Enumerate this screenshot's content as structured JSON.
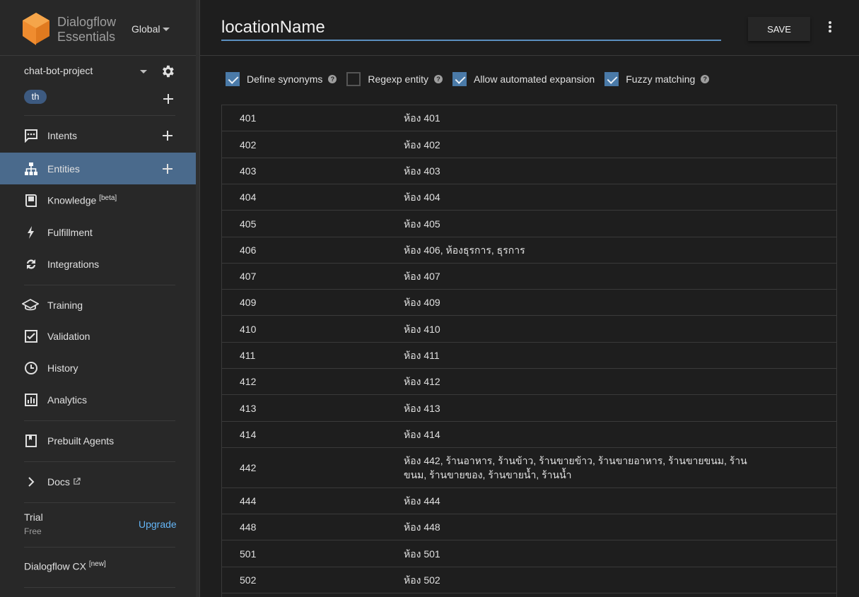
{
  "brand": {
    "line1": "Dialogflow",
    "line2": "Essentials",
    "region": "Global"
  },
  "project": {
    "name": "chat-bot-project",
    "language": "th"
  },
  "nav": {
    "intents": "Intents",
    "entities": "Entities",
    "knowledge": "Knowledge",
    "knowledge_badge": "[beta]",
    "fulfillment": "Fulfillment",
    "integrations": "Integrations",
    "training": "Training",
    "validation": "Validation",
    "history": "History",
    "analytics": "Analytics",
    "prebuilt": "Prebuilt Agents",
    "docs": "Docs"
  },
  "plan": {
    "title": "Trial",
    "sub": "Free",
    "upgrade": "Upgrade"
  },
  "cx": {
    "label": "Dialogflow CX",
    "badge": "[new]"
  },
  "header": {
    "entity_name": "locationName",
    "save": "SAVE"
  },
  "options": {
    "define_synonyms": "Define synonyms",
    "regexp": "Regexp entity",
    "expansion": "Allow automated expansion",
    "fuzzy": "Fuzzy matching"
  },
  "rows": [
    {
      "ref": "401",
      "syn": "ห้อง 401"
    },
    {
      "ref": "402",
      "syn": "ห้อง 402"
    },
    {
      "ref": "403",
      "syn": "ห้อง 403"
    },
    {
      "ref": "404",
      "syn": "ห้อง 404"
    },
    {
      "ref": "405",
      "syn": "ห้อง 405"
    },
    {
      "ref": "406",
      "syn": "ห้อง 406, ห้องธุรการ, ธุรการ"
    },
    {
      "ref": "407",
      "syn": "ห้อง 407"
    },
    {
      "ref": "409",
      "syn": "ห้อง 409"
    },
    {
      "ref": "410",
      "syn": "ห้อง 410"
    },
    {
      "ref": "411",
      "syn": "ห้อง 411"
    },
    {
      "ref": "412",
      "syn": "ห้อง 412"
    },
    {
      "ref": "413",
      "syn": "ห้อง 413"
    },
    {
      "ref": "414",
      "syn": "ห้อง 414"
    },
    {
      "ref": "442",
      "syn": "ห้อง 442, ร้านอาหาร, ร้านข้าว, ร้านขายข้าว, ร้านขายอาหาร, ร้านขายขนม, ร้านขนม, ร้านขายของ, ร้านขายน้ำ, ร้านน้ำ"
    },
    {
      "ref": "444",
      "syn": "ห้อง 444"
    },
    {
      "ref": "448",
      "syn": "ห้อง 448"
    },
    {
      "ref": "501",
      "syn": "ห้อง 501"
    },
    {
      "ref": "502",
      "syn": "ห้อง 502"
    }
  ],
  "colors": {
    "accent": "#4a6a8c",
    "link": "#64b5f6",
    "logo": "#ef8c2f"
  }
}
